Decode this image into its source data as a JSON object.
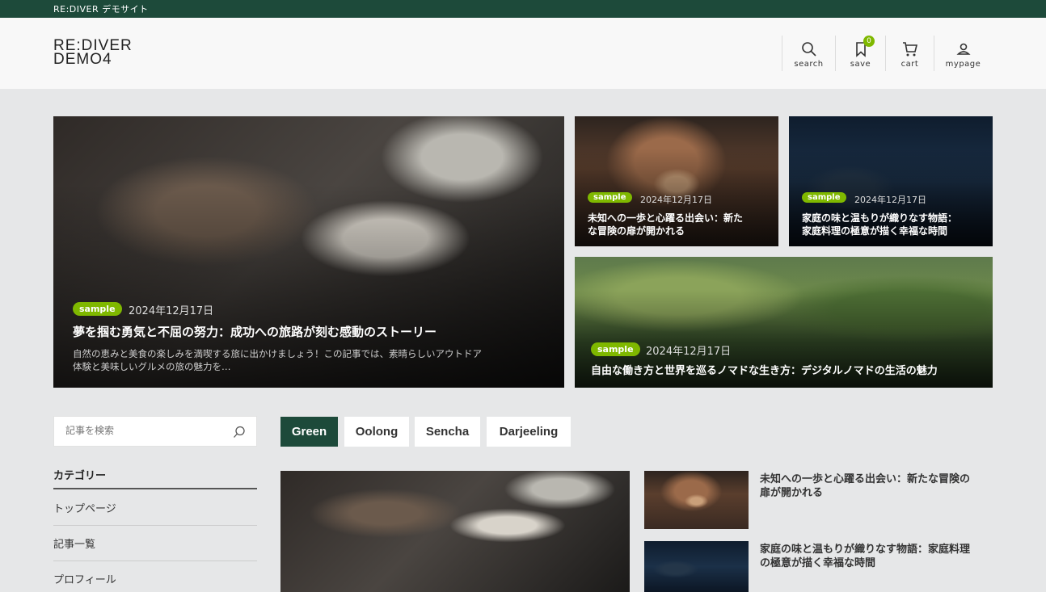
{
  "topbar": {
    "site_name": "RE:DIVER デモサイト"
  },
  "header": {
    "logo_line1": "RE:DIVER",
    "logo_line2": "DEMO4",
    "nav": [
      {
        "label": "search",
        "icon": "search-icon"
      },
      {
        "label": "save",
        "icon": "bookmark-icon",
        "badge": "0"
      },
      {
        "label": "cart",
        "icon": "cart-icon"
      },
      {
        "label": "mypage",
        "icon": "user-icon"
      }
    ]
  },
  "featured": {
    "main": {
      "tag": "sample",
      "date": "2024年12月17日",
      "title": "夢を掴む勇気と不屈の努力：成功への旅路が刻む感動のストーリー",
      "excerpt_line1": "自然の恵みと美食の楽しみを満喫する旅に出かけましょう！この記事では、素晴らしいアウトドア",
      "excerpt_line2": "体験と美味しいグルメの旅の魅力を…"
    },
    "side1": {
      "tag": "sample",
      "date": "2024年12月17日",
      "title_line1": "未知への一歩と心躍る出会い：新た",
      "title_line2": "な冒険の扉が開かれる"
    },
    "side2": {
      "tag": "sample",
      "date": "2024年12月17日",
      "title_line1": "家庭の味と温もりが織りなす物語：",
      "title_line2": "家庭料理の極意が描く幸福な時間"
    },
    "wide": {
      "tag": "sample",
      "date": "2024年12月17日",
      "title": "自由な働き方と世界を巡るノマドな生き方：デジタルノマドの生活の魅力"
    }
  },
  "sidebar": {
    "search_placeholder": "記事を検索",
    "category_heading": "カテゴリー",
    "items": [
      {
        "label": "トップページ"
      },
      {
        "label": "記事一覧"
      },
      {
        "label": "プロフィール"
      }
    ]
  },
  "tabs": [
    {
      "label": "Green",
      "active": true
    },
    {
      "label": "Oolong",
      "active": false
    },
    {
      "label": "Sencha",
      "active": false
    },
    {
      "label": "Darjeeling",
      "active": false
    }
  ],
  "articles": [
    {
      "title_line1": "未知への一歩と心躍る出会い：新たな冒険の",
      "title_line2": "扉が開かれる"
    },
    {
      "title_line1": "家庭の味と温もりが織りなす物語：家庭料理",
      "title_line2": "の極意が描く幸福な時間"
    }
  ],
  "colors": {
    "brand": "#1d4a3a",
    "accent": "#7fb800",
    "background": "#e6e7e8"
  }
}
